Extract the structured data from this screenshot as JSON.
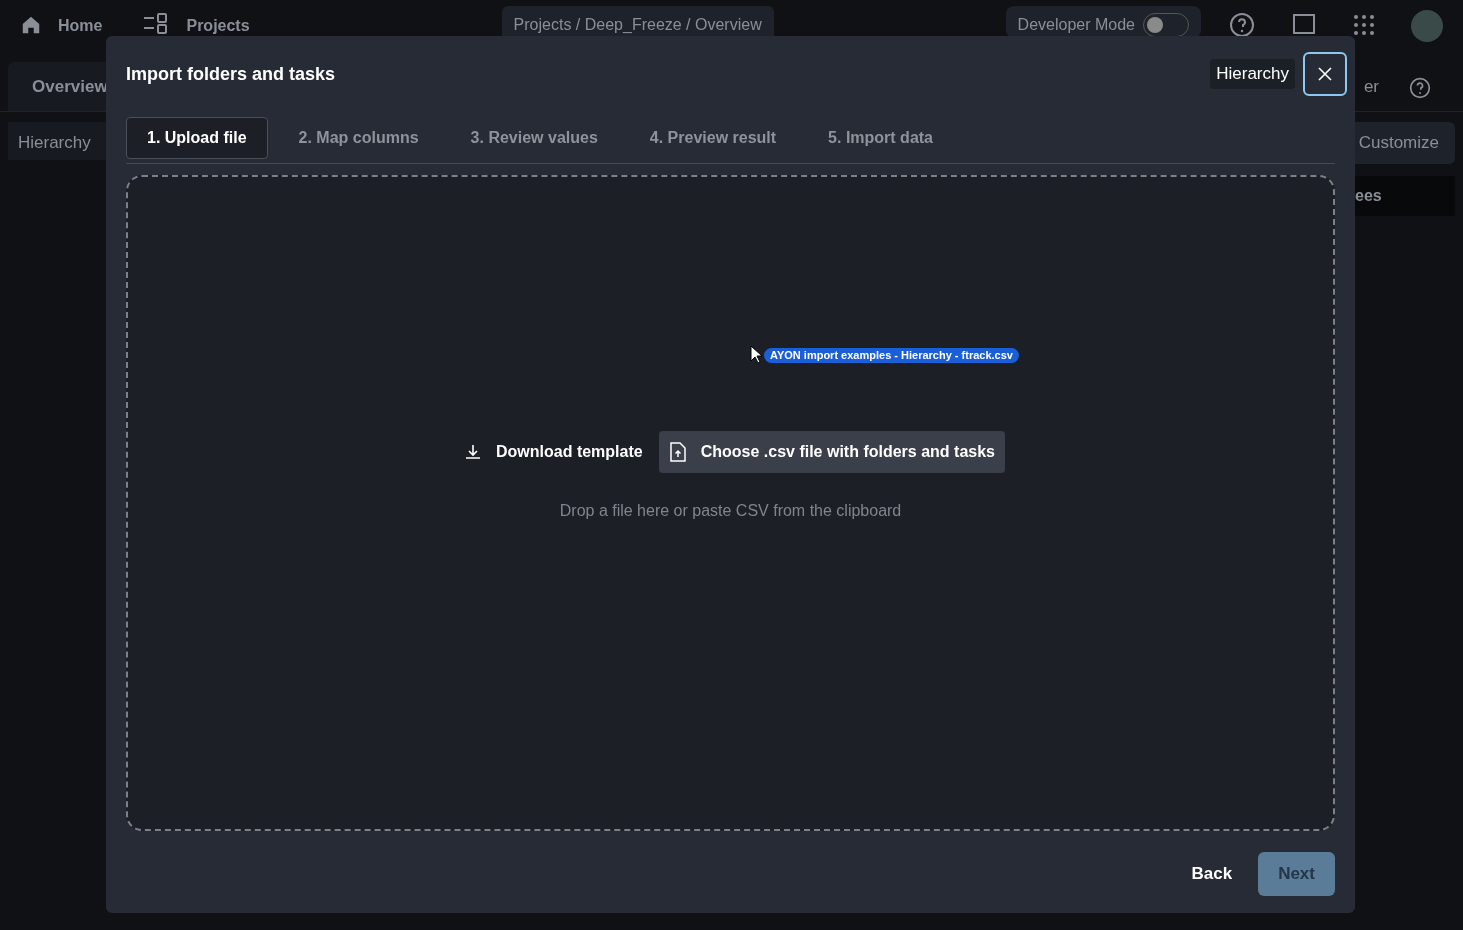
{
  "top_bar": {
    "home": "Home",
    "projects": "Projects",
    "breadcrumb": "Projects / Deep_Freeze / Overview",
    "developer_mode": {
      "label": "Developer Mode",
      "on": false
    }
  },
  "background": {
    "tab": "Overview",
    "tab_fragment": "er",
    "sidebar_title": "Hierarchy",
    "customize": "Customize",
    "panel_fragment": "ees"
  },
  "dialog": {
    "title": "Import folders and tasks",
    "tooltip": "Hierarchy",
    "steps": [
      {
        "label": "1. Upload file",
        "selected": true
      },
      {
        "label": "2. Map columns",
        "selected": false
      },
      {
        "label": "3. Review values",
        "selected": false
      },
      {
        "label": "4. Preview result",
        "selected": false
      },
      {
        "label": "5. Import data",
        "selected": false
      }
    ],
    "drag_file": "AYON import examples - Hierarchy - ftrack.csv",
    "download_template": "Download template",
    "choose_file": "Choose .csv file with folders and tasks",
    "drop_hint": "Drop a file here or paste CSV from the clipboard",
    "back": "Back",
    "next": {
      "label": "Next",
      "disabled": true
    }
  }
}
